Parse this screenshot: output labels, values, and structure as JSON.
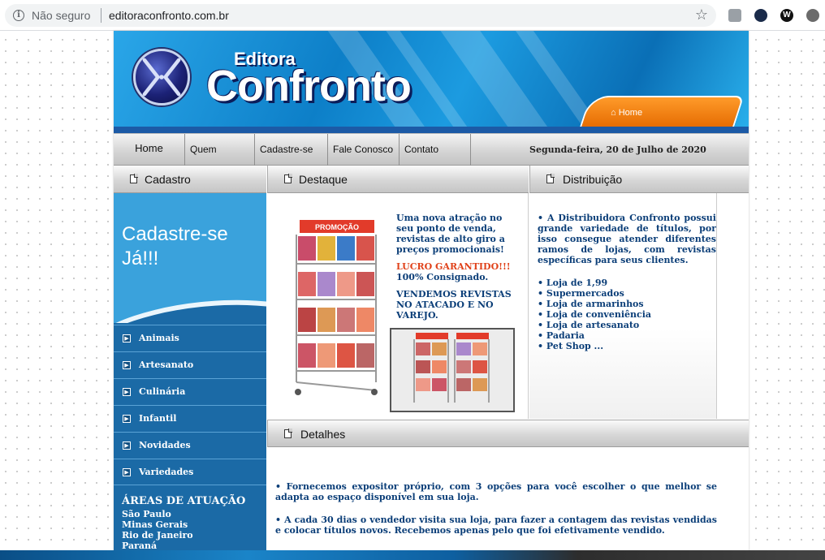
{
  "browser": {
    "security_label": "Não seguro",
    "url": "editoraconfronto.com.br"
  },
  "banner": {
    "brand_small": "Editora",
    "brand_big": "Confronto",
    "home_link": "Home"
  },
  "nav": {
    "items": [
      {
        "label": "Home"
      },
      {
        "label": "Quem Somos"
      },
      {
        "label": "Cadastre-se"
      },
      {
        "label": "Fale Conosco"
      },
      {
        "label": "Contato"
      }
    ],
    "date": "Segunda-feira, 20 de Julho de 2020"
  },
  "sections": {
    "cadastro": "Cadastro",
    "destaque": "Destaque",
    "distribuicao": "Distribuição",
    "detalhes": "Detalhes"
  },
  "sidebar": {
    "cadastre_line1": "Cadastre-se",
    "cadastre_line2": "Já!!!",
    "menu": [
      "Animais",
      "Artesanato",
      "Culinária",
      "Infantil",
      "Novidades",
      "Variedades"
    ],
    "areas_title": "ÁREAS DE ATUAÇÃO",
    "areas": [
      "São Paulo",
      "Minas Gerais",
      "Rio de Janeiro",
      "Paraná"
    ]
  },
  "destaque": {
    "p1": "Uma nova atração no seu ponto de venda, revistas de alto giro a preços promocionais!",
    "p2_red": "LUCRO GARANTIDO!!!",
    "p2_rest": "100% Consignado.",
    "p3": "VENDEMOS REVISTAS NO ATACADO E NO VAREJO.",
    "rack_sign": "PROMOÇÃO"
  },
  "distribuicao": {
    "intro": "•  A Distribuidora Confronto possui grande variedade de títulos, por isso consegue atender diferentes ramos de lojas, com revistas específicas para seus clientes.",
    "items": [
      "Loja de 1,99",
      "Supermercados",
      "Loja de armarinhos",
      "Loja de conveniência",
      "Loja de artesanato",
      "Padaria",
      "Pet Shop ..."
    ]
  },
  "detalhes": {
    "p1": "•   Fornecemos expositor próprio, com 3 opções para você escolher o que melhor se adapta ao espaço disponível em sua loja.",
    "p2": "•   A cada 30 dias o vendedor visita sua loja, para fazer a contagem das revistas vendidas e colocar títulos novos. Recebemos apenas pelo que foi efetivamente vendido."
  }
}
